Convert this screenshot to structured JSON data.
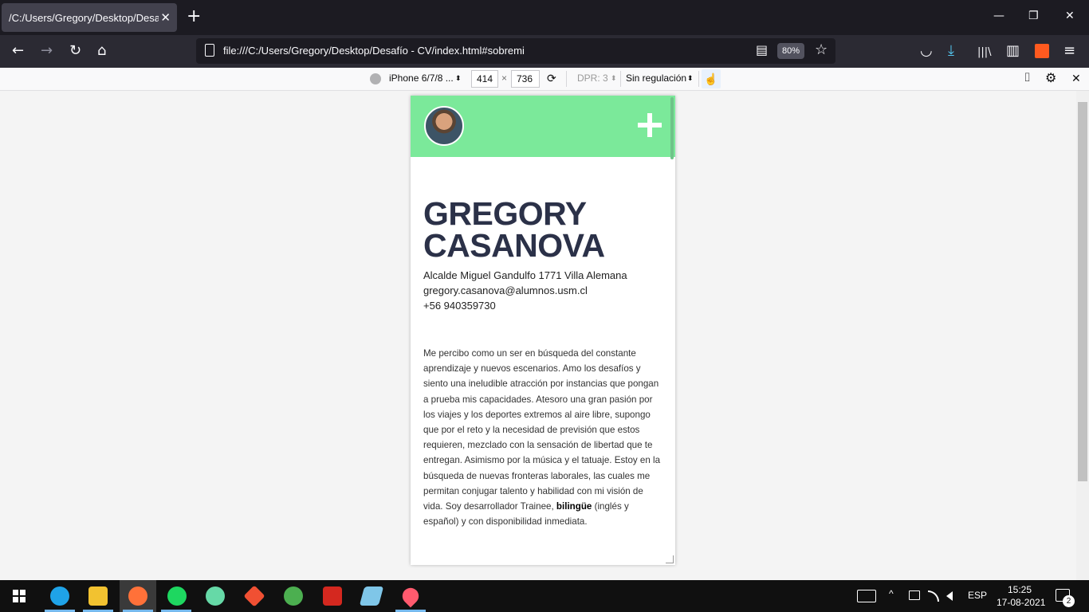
{
  "browser": {
    "tab_title": "/C:/Users/Gregory/Desktop/Desafío",
    "url": "file:///C:/Users/Gregory/Desktop/Desafío - CV/index.html#sobremi",
    "zoom": "80%",
    "icons": {
      "close": "✕",
      "new_tab": "+",
      "minimize": "—",
      "restore": "❐",
      "win_close": "✕",
      "back": "←",
      "forward": "→",
      "reload": "↻",
      "home": "⌂",
      "reader": "▤",
      "bookmark": "☆",
      "pocket": "◡",
      "download": "⤓",
      "library": "|||\\",
      "sidebar": "▥",
      "menu": "≡"
    }
  },
  "responsive_toolbar": {
    "device": "iPhone 6/7/8 ...",
    "width": "414",
    "times": "×",
    "height": "736",
    "dpr": "DPR: 3",
    "throttling": "Sin regulación",
    "dropdown_arrow": "⬍",
    "icons": {
      "rotate": "⟳",
      "touch": "☝",
      "screenshot": "⌷",
      "settings": "⚙",
      "close": "✕"
    }
  },
  "cv": {
    "name_line1": "GREGORY",
    "name_line2": "CASANOVA",
    "address": "Alcalde Miguel Gandulfo 1771 Villa Alemana",
    "email": "gregory.casanova@alumnos.usm.cl",
    "phone": "+56 940359730",
    "about_before_bold": "Me percibo como un ser en búsqueda del constante aprendizaje y nuevos escenarios. Amo los desafíos y siento una ineludible atracción por instancias que pongan a prueba mis capacidades. Atesoro una gran pasión por los viajes y los deportes extremos al aire libre, supongo que por el reto y la necesidad de previsión que estos requieren, mezclado con la sensación de libertad que te entregan. Asimismo por la música y el tatuaje. Estoy en la búsqueda de nuevas fronteras laborales, las cuales me permitan conjugar talento y habilidad con mi visión de vida. Soy desarrollador Trainee, ",
    "about_bold": "bilingüe",
    "about_after_bold": " (inglés y español) y con disponibilidad inmediata."
  },
  "taskbar": {
    "language": "ESP",
    "time": "15:25",
    "date": "17-08-2021",
    "notifications": "2",
    "tray_expand": "^",
    "colors": {
      "edge": "#1fa3e8",
      "explorer": "#f2c230",
      "firefox": "#ff7139",
      "spotify": "#1ed760",
      "atom": "#66d9a7",
      "git": "#f05033",
      "chrome": "#4caf50",
      "acrobat": "#d4281f",
      "notepad": "#7fc6e8",
      "app": "#ff5a6e"
    }
  }
}
